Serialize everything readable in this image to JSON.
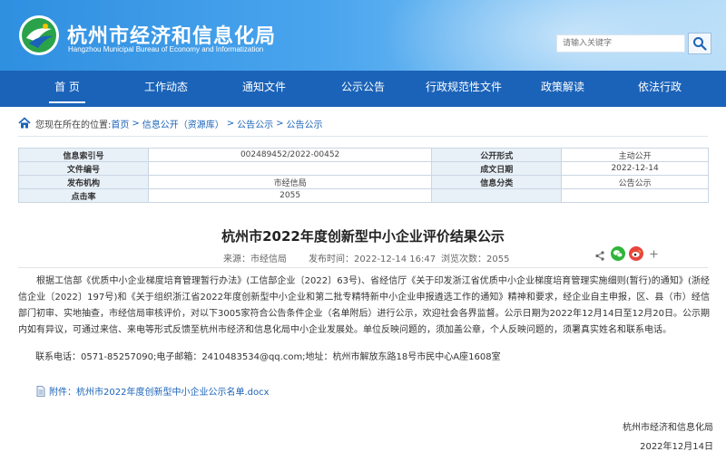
{
  "header": {
    "title": "杭州市经济和信息化局",
    "subtitle": "Hangzhou Municipal Bureau of Economy and Informatization",
    "search": {
      "placeholder": "请输入关键字"
    }
  },
  "nav": {
    "items": [
      {
        "label": "首 页",
        "active": true
      },
      {
        "label": "工作动态"
      },
      {
        "label": "通知文件"
      },
      {
        "label": "公示公告"
      },
      {
        "label": "行政规范性文件"
      },
      {
        "label": "政策解读"
      },
      {
        "label": "依法行政"
      }
    ]
  },
  "breadcrumb": {
    "prefix": "您现在所在的位置:",
    "items": [
      "首页",
      "信息公开（资源库）",
      "公告公示",
      "公告公示"
    ],
    "separator": ">"
  },
  "info_table": {
    "rows": [
      [
        "信息索引号",
        "002489452/2022-00452",
        "公开形式",
        "主动公开"
      ],
      [
        "文件编号",
        "",
        "成文日期",
        "2022-12-14"
      ],
      [
        "发布机构",
        "市经信局",
        "信息分类",
        "公告公示"
      ],
      [
        "点击率",
        "2055",
        "",
        ""
      ]
    ]
  },
  "article": {
    "title": "杭州市2022年度创新型中小企业评价结果公示",
    "source": "来源：市经信局",
    "publish_time": "发布时间：2022-12-14 16:47",
    "views": "浏览次数：2055",
    "paragraph": "根据工信部《优质中小企业梯度培育管理暂行办法》(工信部企业〔2022〕63号)、省经信厅《关于印发浙江省优质中小企业梯度培育管理实施细则(暂行)的通知》(浙经信企业〔2022〕197号)和《关于组织浙江省2022年度创新型中小企业和第二批专精特新中小企业申报遴选工作的通知》精神和要求，经企业自主申报，区、县（市）经信部门初审、实地抽查，市经信局审核评价，对以下3005家符合公告条件企业（名单附后）进行公示，欢迎社会各界监督。公示日期为2022年12月14日至12月20日。公示期内如有异议，可通过来信、来电等形式反馈至杭州市经济和信息化局中小企业发展处。单位反映问题的，须加盖公章，个人反映问题的，须署真实姓名和联系电话。",
    "contact": "联系电话：0571-85257090;电子邮箱：2410483534@qq.com;地址：杭州市解放东路18号市民中心A座1608室",
    "attachment": "附件：杭州市2022年度创新型中小企业公示名单.docx",
    "signoff_org": "杭州市经济和信息化局",
    "signoff_date": "2022年12月14日"
  },
  "icons": {
    "logo": "bureau-logo-icon",
    "search": "search-icon",
    "home": "home-icon",
    "share": "share-icon",
    "wechat": "wechat-icon",
    "weibo": "weibo-icon",
    "more": "plus-icon",
    "file": "document-icon"
  },
  "colors": {
    "nav": "#1b63b8",
    "link": "#1b63b8",
    "table_key_bg": "#e8f0f8"
  }
}
